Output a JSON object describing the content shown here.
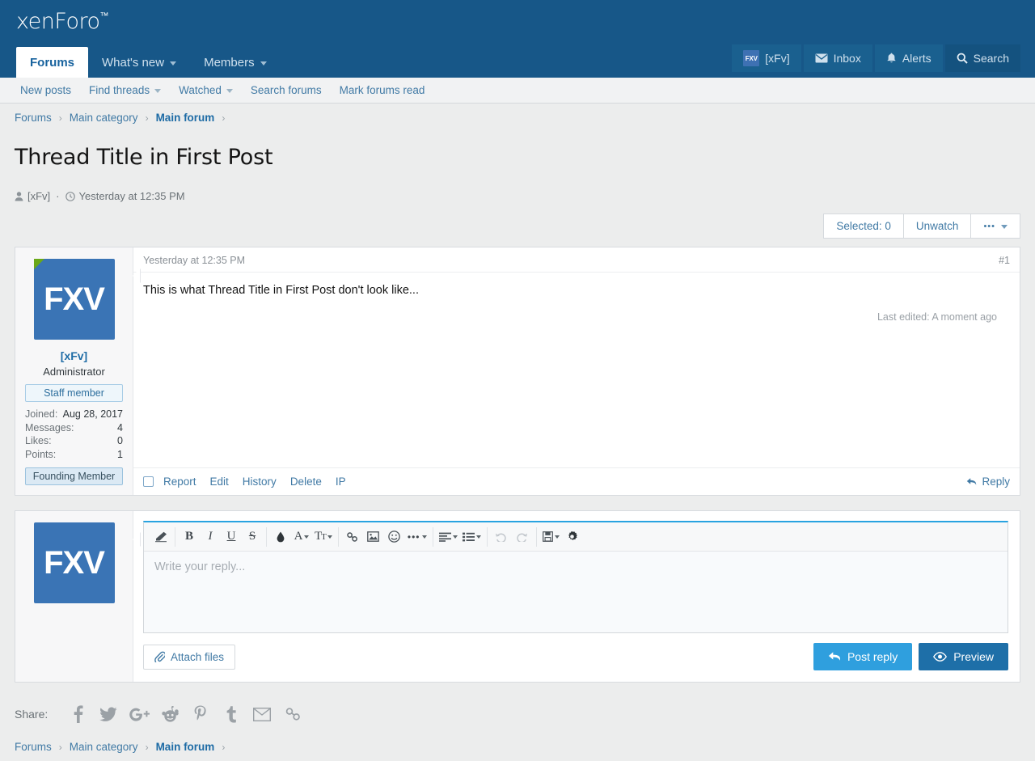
{
  "site": {
    "logo": "xenForo",
    "logo_tm": "™"
  },
  "nav": {
    "tabs": [
      {
        "label": "Forums",
        "active": true,
        "caret": false
      },
      {
        "label": "What's new",
        "active": false,
        "caret": true
      },
      {
        "label": "Members",
        "active": false,
        "caret": true
      }
    ],
    "right": [
      {
        "label": "[xFv]",
        "icon": "avatar-icon",
        "avatar_text": "FXV"
      },
      {
        "label": "Inbox",
        "icon": "envelope-icon"
      },
      {
        "label": "Alerts",
        "icon": "bell-icon"
      },
      {
        "label": "Search",
        "icon": "search-icon"
      }
    ]
  },
  "subnav": {
    "items": [
      {
        "label": "New posts",
        "caret": false
      },
      {
        "label": "Find threads",
        "caret": true
      },
      {
        "label": "Watched",
        "caret": true
      },
      {
        "label": "Search forums",
        "caret": false
      },
      {
        "label": "Mark forums read",
        "caret": false
      }
    ]
  },
  "breadcrumb": {
    "items": [
      {
        "label": "Forums",
        "current": false
      },
      {
        "label": "Main category",
        "current": false
      },
      {
        "label": "Main forum",
        "current": true
      }
    ],
    "separator": "›"
  },
  "thread": {
    "title": "Thread Title in First Post",
    "author": "[xFv]",
    "meta_dot": "·",
    "date": "Yesterday at 12:35 PM"
  },
  "actionbar": {
    "selected_label": "Selected: 0",
    "unwatch_label": "Unwatch",
    "more_label": "•••"
  },
  "post": {
    "date": "Yesterday at 12:35 PM",
    "number": "#1",
    "text": "This is what Thread Title in First Post don't look like...",
    "last_edited": "Last edited: A moment ago",
    "user": {
      "avatar_text": "FXV",
      "name": "[xFv]",
      "title": "Administrator",
      "staff_banner": "Staff member",
      "founding_banner": "Founding Member",
      "stats": [
        {
          "key": "Joined:",
          "value": "Aug 28, 2017"
        },
        {
          "key": "Messages:",
          "value": "4"
        },
        {
          "key": "Likes:",
          "value": "0"
        },
        {
          "key": "Points:",
          "value": "1"
        }
      ]
    },
    "footer_links": [
      "Report",
      "Edit",
      "History",
      "Delete",
      "IP"
    ],
    "reply_label": "Reply"
  },
  "editor": {
    "avatar_text": "FXV",
    "placeholder": "Write your reply...",
    "toolbar": [
      {
        "name": "remove-formatting-icon",
        "glyph": "eraser",
        "caret": false,
        "dim": false
      },
      {
        "name": "bold-icon",
        "glyph": "B",
        "caret": false,
        "dim": false
      },
      {
        "name": "italic-icon",
        "glyph": "I",
        "caret": false,
        "dim": false
      },
      {
        "name": "underline-icon",
        "glyph": "U",
        "caret": false,
        "dim": false
      },
      {
        "name": "strikethrough-icon",
        "glyph": "S",
        "caret": false,
        "dim": false
      },
      {
        "name": "text-color-icon",
        "glyph": "droplet",
        "caret": false,
        "dim": false
      },
      {
        "name": "font-family-icon",
        "glyph": "A",
        "caret": true,
        "dim": false
      },
      {
        "name": "font-size-icon",
        "glyph": "TT",
        "caret": true,
        "dim": false
      },
      {
        "name": "link-icon",
        "glyph": "link",
        "caret": false,
        "dim": false
      },
      {
        "name": "image-icon",
        "glyph": "image",
        "caret": false,
        "dim": false
      },
      {
        "name": "smilie-icon",
        "glyph": "smiley",
        "caret": false,
        "dim": false
      },
      {
        "name": "more-options-icon",
        "glyph": "dots",
        "caret": true,
        "dim": false
      },
      {
        "name": "align-icon",
        "glyph": "align",
        "caret": true,
        "dim": false
      },
      {
        "name": "list-icon",
        "glyph": "list",
        "caret": true,
        "dim": false
      },
      {
        "name": "undo-icon",
        "glyph": "undo",
        "caret": false,
        "dim": true
      },
      {
        "name": "redo-icon",
        "glyph": "redo",
        "caret": false,
        "dim": true
      },
      {
        "name": "draft-icon",
        "glyph": "floppy",
        "caret": true,
        "dim": false
      },
      {
        "name": "settings-icon",
        "glyph": "gear",
        "caret": false,
        "dim": false
      }
    ],
    "attach_label": "Attach files",
    "post_reply_label": "Post reply",
    "preview_label": "Preview"
  },
  "share": {
    "label": "Share:",
    "icons": [
      "facebook-icon",
      "twitter-icon",
      "google-plus-icon",
      "reddit-icon",
      "pinterest-icon",
      "tumblr-icon",
      "email-icon",
      "link-icon"
    ]
  },
  "colors": {
    "header_blue": "#175788",
    "accent_blue": "#2f9fde",
    "link_blue": "#417aa5",
    "avatar_blue": "#3a74b5",
    "online_green": "#6aa818",
    "page_bg": "#eceded"
  }
}
